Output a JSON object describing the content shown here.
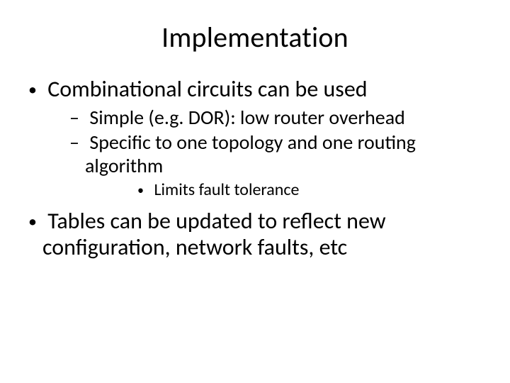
{
  "title": "Implementation",
  "bullets": [
    {
      "text": "Combinational circuits can be used",
      "children": [
        {
          "text": "Simple (e.g. DOR): low router overhead"
        },
        {
          "text": "Specific to one topology and one routing algorithm",
          "children": [
            {
              "text": "Limits fault tolerance"
            }
          ]
        }
      ]
    },
    {
      "text": "Tables can be updated to reflect new configuration, network faults, etc"
    }
  ]
}
